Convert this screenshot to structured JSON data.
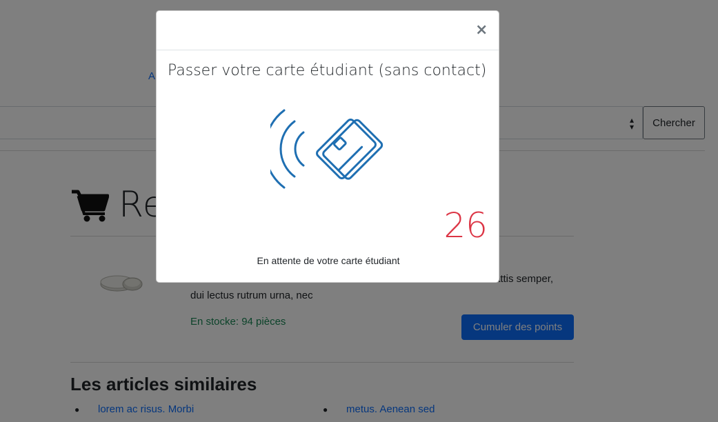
{
  "page": {
    "top_link": "A",
    "search_button_label": "Chercher",
    "cart_title": "Re",
    "product": {
      "description_line1": "",
      "description_line1_tail": "attis semper,",
      "description_line2": "dui lectus rutrum urna, nec",
      "stock": "En stocke: 94 pièces",
      "points_button_label": "Cumuler des points"
    },
    "similar": {
      "heading": "Les articles similaires",
      "items": [
        {
          "label": "lorem ac risus. Morbi"
        },
        {
          "label": "metus. Aenean sed"
        }
      ]
    }
  },
  "modal": {
    "close_label": "×",
    "title": "Passer votre carte étudiant (sans contact)",
    "countdown": "26",
    "waiting_text": "En attente de votre carte étudiant"
  },
  "colors": {
    "accent_blue": "#0d6efd",
    "nfc_icon_blue": "#1f6fb2",
    "countdown_red": "#dc3545",
    "stock_green": "#198754"
  },
  "icons": {
    "cart": "shopping-cart-icon",
    "nfc": "contactless-card-icon",
    "close": "close-icon",
    "select_caret": "sort-caret-icon"
  }
}
